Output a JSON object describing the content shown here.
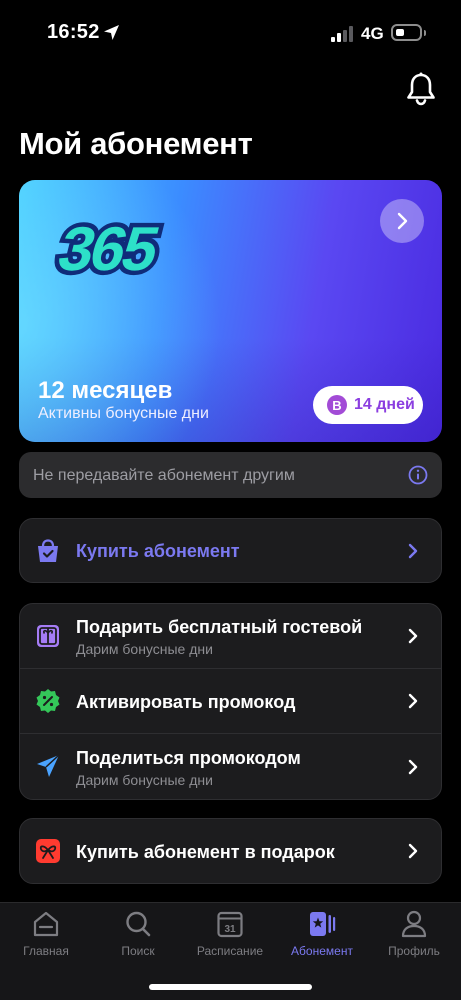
{
  "status_bar": {
    "time": "16:52",
    "network": "4G"
  },
  "header": {
    "title": "Мой абонемент"
  },
  "subscription_card": {
    "logo_text": "365",
    "title": "12 месяцев",
    "subtitle": "Активны бонусные дни",
    "badge_letter": "B",
    "badge_text": "14 дней"
  },
  "notice": {
    "text": "Не передавайте абонемент другим"
  },
  "buy": {
    "label": "Купить абонемент"
  },
  "actions": [
    {
      "title": "Подарить бесплатный гостевой",
      "subtitle": "Дарим бонусные дни"
    },
    {
      "title": "Активировать промокод"
    },
    {
      "title": "Поделиться промокодом",
      "subtitle": "Дарим бонусные дни"
    }
  ],
  "gift": {
    "label": "Купить абонемент в подарок"
  },
  "tabbar": {
    "tabs": [
      {
        "label": "Главная",
        "icon": "home-icon"
      },
      {
        "label": "Поиск",
        "icon": "search-icon"
      },
      {
        "label": "Расписание",
        "icon": "calendar-icon",
        "day": "31"
      },
      {
        "label": "Абонемент",
        "icon": "membership-icon",
        "active": true
      },
      {
        "label": "Профиль",
        "icon": "profile-icon"
      }
    ]
  },
  "colors": {
    "accent": "#7b79f0",
    "background": "#000000",
    "card_bg": "#1c1c1e",
    "badge_text": "#8b3ee0",
    "promo_icon": "#34c759",
    "share_icon": "#4aa3ff",
    "gift_icon": "#ff3b30"
  }
}
